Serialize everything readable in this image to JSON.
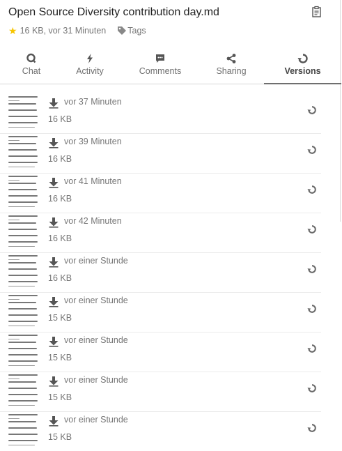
{
  "file": {
    "title": "Open Source Diversity contribution day.md",
    "meta_info": "16 KB, vor 31 Minuten",
    "tags_label": "Tags",
    "star_icon": "star-icon",
    "star_color": "#f7c500"
  },
  "tabs": [
    {
      "label": "Chat",
      "icon": "chat-icon"
    },
    {
      "label": "Activity",
      "icon": "activity-icon"
    },
    {
      "label": "Comments",
      "icon": "comments-icon"
    },
    {
      "label": "Sharing",
      "icon": "share-icon"
    },
    {
      "label": "Versions",
      "icon": "history-icon",
      "active": true
    }
  ],
  "versions": [
    {
      "time": "vor 37 Minuten",
      "size": "16 KB"
    },
    {
      "time": "vor 39 Minuten",
      "size": "16 KB"
    },
    {
      "time": "vor 41 Minuten",
      "size": "16 KB"
    },
    {
      "time": "vor 42 Minuten",
      "size": "16 KB"
    },
    {
      "time": "vor einer Stunde",
      "size": "16 KB"
    },
    {
      "time": "vor einer Stunde",
      "size": "15 KB"
    },
    {
      "time": "vor einer Stunde",
      "size": "15 KB"
    },
    {
      "time": "vor einer Stunde",
      "size": "15 KB"
    },
    {
      "time": "vor einer Stunde",
      "size": "15 KB"
    }
  ]
}
